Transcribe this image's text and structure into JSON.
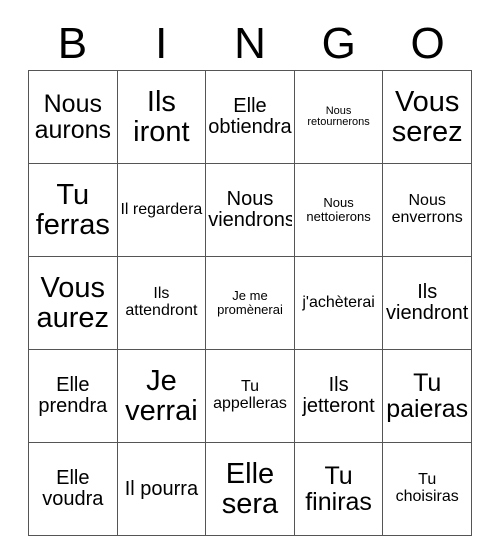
{
  "card": {
    "title": "BINGO",
    "header_letters": [
      "B",
      "I",
      "N",
      "G",
      "O"
    ],
    "columns": 5,
    "rows": 5,
    "colors": {
      "background": "#ffffff",
      "text": "#000000",
      "grid_line": "#555555"
    },
    "cells": [
      [
        {
          "text": "Nous aurons",
          "size": "lg"
        },
        {
          "text": "Ils iront",
          "size": "xl"
        },
        {
          "text": "Elle obtiendra",
          "size": "md"
        },
        {
          "text": "Nous retournerons",
          "size": "xxs"
        },
        {
          "text": "Vous serez",
          "size": "xl"
        }
      ],
      [
        {
          "text": "Tu ferras",
          "size": "xl"
        },
        {
          "text": "Il regardera",
          "size": "sm"
        },
        {
          "text": "Nous viendrons",
          "size": "md"
        },
        {
          "text": "Nous nettoierons",
          "size": "xs"
        },
        {
          "text": "Nous enverrons",
          "size": "sm"
        }
      ],
      [
        {
          "text": "Vous aurez",
          "size": "xl"
        },
        {
          "text": "Ils attendront",
          "size": "sm"
        },
        {
          "text": "Je me promènerai",
          "size": "xs"
        },
        {
          "text": "j'achèterai",
          "size": "sm"
        },
        {
          "text": "Ils viendront",
          "size": "md"
        }
      ],
      [
        {
          "text": "Elle prendra",
          "size": "md"
        },
        {
          "text": "Je verrai",
          "size": "xl"
        },
        {
          "text": "Tu appelleras",
          "size": "sm"
        },
        {
          "text": "Ils jetteront",
          "size": "md"
        },
        {
          "text": "Tu paieras",
          "size": "lg"
        }
      ],
      [
        {
          "text": "Elle voudra",
          "size": "md"
        },
        {
          "text": "Il pourra",
          "size": "md"
        },
        {
          "text": "Elle sera",
          "size": "xl"
        },
        {
          "text": "Tu finiras",
          "size": "lg"
        },
        {
          "text": "Tu choisiras",
          "size": "sm"
        }
      ]
    ]
  }
}
